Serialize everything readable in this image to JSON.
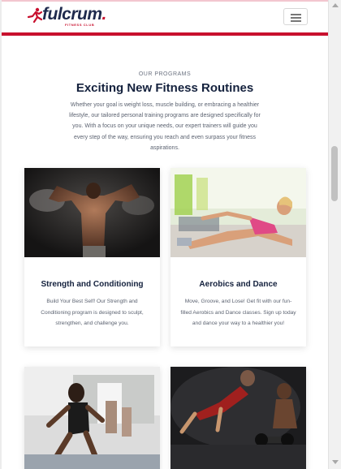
{
  "header": {
    "logo_text": "fulcrum",
    "logo_dot": ".",
    "logo_subtext": "FITNESS CLUB",
    "menu_icon": "hamburger-menu-icon",
    "brand_color": "#c8102e",
    "navy_color": "#1f2a4d"
  },
  "section": {
    "eyebrow": "OUR PROGRAMS",
    "title": "Exciting New Fitness Routines",
    "intro": "Whether your goal is weight loss, muscle building, or embracing a healthier lifestyle, our tailored personal training programs are designed specifically for you. With a focus on your unique needs, our expert trainers will guide you every step of the way, ensuring you reach and even surpass your fitness aspirations."
  },
  "programs": [
    {
      "title": "Strength and Conditioning",
      "text": "Build Your Best Self! Our Strength and Conditioning program is designed to sculpt, strengthen, and challenge you.",
      "image": "bodybuilder-back-photo"
    },
    {
      "title": "Aerobics and Dance",
      "text": "Move, Groove, and Lose! Get fit with our fun-filled Aerobics and Dance classes. Sign up today and dance your way to a healthier you!",
      "image": "woman-stretching-gym-photo"
    },
    {
      "title": "",
      "text": "",
      "image": "group-step-class-photo"
    },
    {
      "title": "",
      "text": "",
      "image": "pushup-dumbbells-photo"
    }
  ]
}
